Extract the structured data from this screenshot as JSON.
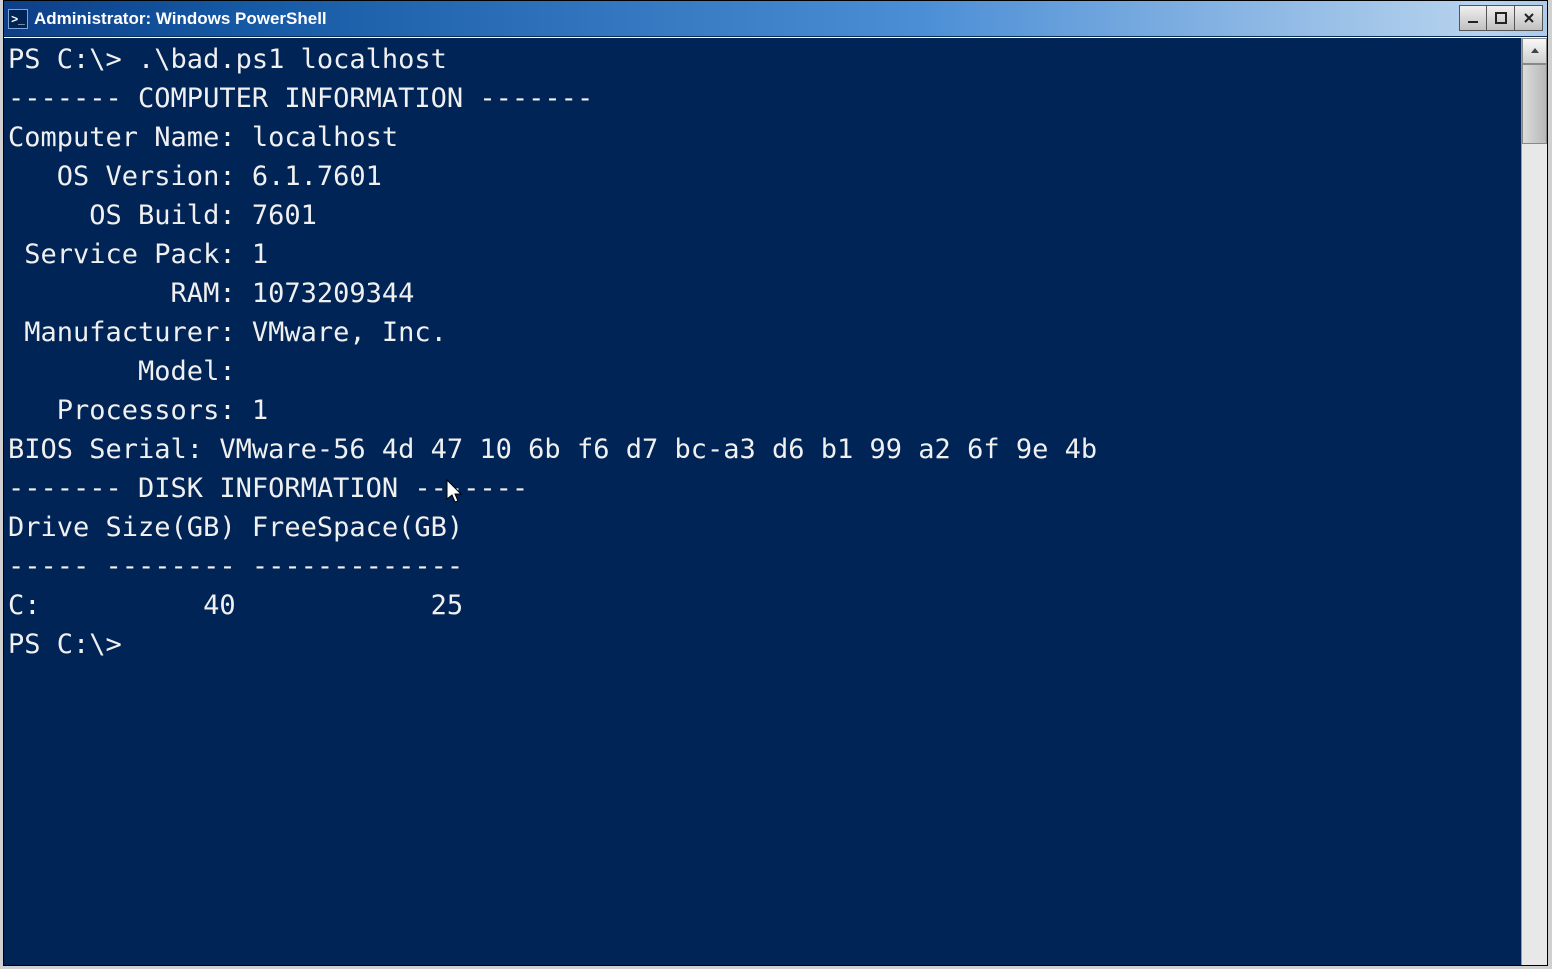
{
  "window": {
    "title": "Administrator: Windows PowerShell",
    "icon_glyph": ">_"
  },
  "console": {
    "lines": [
      "PS C:\\> .\\bad.ps1 localhost",
      "------- COMPUTER INFORMATION -------",
      "Computer Name: localhost",
      "   OS Version: 6.1.7601",
      "     OS Build: 7601",
      " Service Pack: 1",
      "          RAM: 1073209344",
      " Manufacturer: VMware, Inc.",
      "        Model:",
      "   Processors: 1",
      "BIOS Serial: VMware-56 4d 47 10 6b f6 d7 bc-a3 d6 b1 99 a2 6f 9e 4b",
      "",
      "------- DISK INFORMATION -------",
      "",
      "Drive Size(GB) FreeSpace(GB)",
      "----- -------- -------------",
      "C:          40            25",
      "",
      "",
      "PS C:\\>"
    ]
  },
  "info_parsed": {
    "command": ".\\bad.ps1 localhost",
    "computer": {
      "name": "localhost",
      "os_version": "6.1.7601",
      "os_build": "7601",
      "service_pack": "1",
      "ram": "1073209344",
      "manufacturer": "VMware, Inc.",
      "model": "",
      "processors": "1",
      "bios_serial": "VMware-56 4d 47 10 6b f6 d7 bc-a3 d6 b1 99 a2 6f 9e 4b"
    },
    "disks": [
      {
        "drive": "C:",
        "size_gb": 40,
        "freespace_gb": 25
      }
    ],
    "prompt": "PS C:\\>"
  }
}
